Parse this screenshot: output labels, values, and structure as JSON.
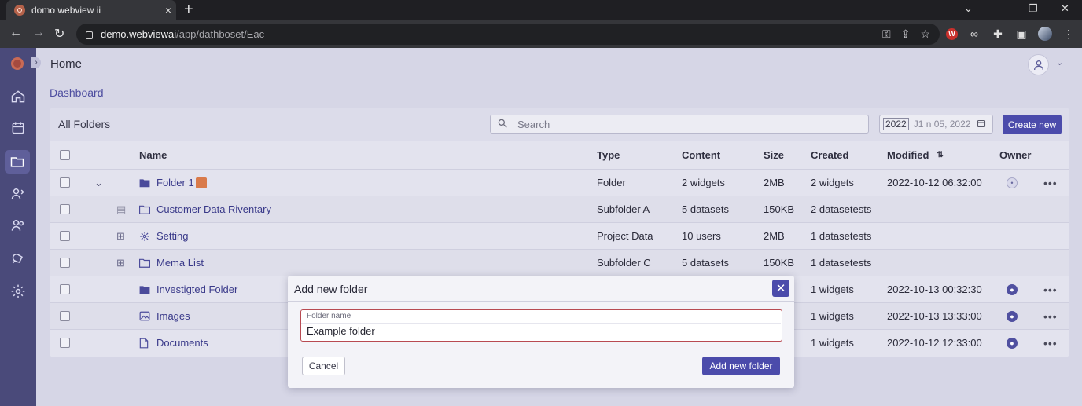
{
  "browser": {
    "tab_title": "domo webview ii",
    "new_tab": "+",
    "url_host": "demo.webviewai",
    "url_path": "/app/dathboset/Eac"
  },
  "app": {
    "page_title": "Home",
    "breadcrumb": "Dashboard"
  },
  "toolbar": {
    "title": "All Folders",
    "search_placeholder": "Search",
    "date_year": "2022",
    "date_rest": "J1 n 05, 2022",
    "create_label": "Create new"
  },
  "table": {
    "headers": {
      "name": "Name",
      "type": "Type",
      "content": "Content",
      "size": "Size",
      "created": "Created",
      "modified": "Modified",
      "owner": "Owner"
    },
    "rows": [
      {
        "name": "Folder 1",
        "type": "Folder",
        "content": "2 widgets",
        "size": "2MB",
        "created": "2 widgets",
        "modified": "2022-10-12 06:32:00"
      },
      {
        "name": "Customer Data Riventary",
        "type": "Subfolder A",
        "content": "5 datasets",
        "size": "150KB",
        "created": "2 datasetests",
        "modified": ""
      },
      {
        "name": "Setting",
        "type": "Project Data",
        "content": "10 users",
        "size": "2MB",
        "created": "1 datasetests",
        "modified": ""
      },
      {
        "name": "Mema List",
        "type": "Subfolder C",
        "content": "5 datasets",
        "size": "150KB",
        "created": "1 datasetests",
        "modified": ""
      },
      {
        "name": "Investigted Folder",
        "type": "",
        "content": "",
        "size": "",
        "created": "1 widgets",
        "modified": "2022-10-13 00:32:30"
      },
      {
        "name": "Images",
        "type": "",
        "content": "",
        "size": "",
        "created": "1 widgets",
        "modified": "2022-10-13 13:33:00"
      },
      {
        "name": "Documents",
        "type": "",
        "content": "",
        "size": "",
        "created": "1 widgets",
        "modified": "2022-10-12 12:33:00"
      }
    ]
  },
  "modal": {
    "title": "Add new folder",
    "field_label": "Folder name",
    "field_value": "Example folder",
    "cancel_label": "Cancel",
    "submit_label": "Add new folder"
  },
  "colors": {
    "accent": "#4b4bab",
    "sidebar": "#4a4a7a",
    "error_border": "#b84a52"
  }
}
